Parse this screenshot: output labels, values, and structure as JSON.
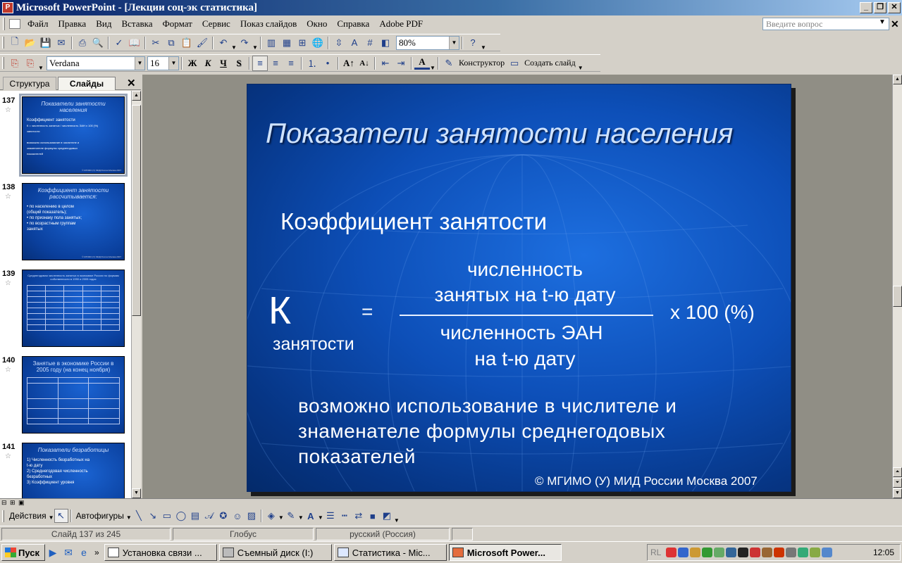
{
  "window": {
    "title": "Microsoft PowerPoint - [Лекции соц-эк статистика]"
  },
  "menu": {
    "items": [
      "Файл",
      "Правка",
      "Вид",
      "Вставка",
      "Формат",
      "Сервис",
      "Показ слайдов",
      "Окно",
      "Справка",
      "Adobe PDF"
    ],
    "help_placeholder": "Введите вопрос"
  },
  "toolbar": {
    "zoom": "80%",
    "font_name": "Verdana",
    "font_size": "16",
    "bold_label": "Ж",
    "italic_label": "К",
    "underline_label": "Ч",
    "shadow_label": "S",
    "designer_label": "Конструктор",
    "new_slide_label": "Создать слайд"
  },
  "left_panel": {
    "tab_structure": "Структура",
    "tab_slides": "Слайды",
    "thumbnails": [
      {
        "number": "137",
        "title": "Показатели занятости населения",
        "lines": [
          "Коэффициент занятости",
          "К  =  численность занятых / численность ЭАН  x 100 (%)",
          "занятости",
          "возможно использование в числителе и",
          "знаменателе формулы среднегодовых",
          "показателей"
        ]
      },
      {
        "number": "138",
        "title": "Коэффициент занятости рассчитывается:",
        "lines": [
          "• по населению в целом",
          "  (общий показатель);",
          "• по признаку пола занятых;",
          "• по возрастным группам",
          "  занятых"
        ]
      },
      {
        "number": "139",
        "title": "Среднегодовая численность занятых в экономике России по формам собственности в 1990 и 2005 годах",
        "lines": []
      },
      {
        "number": "140",
        "title": "Занятые в экономике России в 2005 году (на конец ноября)",
        "lines": []
      },
      {
        "number": "141",
        "title": "Показатели безработицы",
        "lines": [
          "1) Численность безработных на",
          "   t-ю дату",
          "2) Среднегодовая численность",
          "   безработных",
          "3) Коэффициент уровня"
        ]
      }
    ]
  },
  "slide": {
    "title": "Показатели занятости населения",
    "heading": "Коэффициент занятости",
    "k_letter": "К",
    "k_subscript": "занятости",
    "equals": "=",
    "numerator_line1": "численность",
    "numerator_line2": "занятых на t-ю дату",
    "denominator_line1": "численность ЭАН",
    "denominator_line2": "на t-ю дату",
    "multiplier": "x 100 (%)",
    "note": "возможно использование в числителе и знаменателе формулы среднегодовых показателей",
    "copyright": "© МГИМО (У) МИД России Москва 2007"
  },
  "drawing_toolbar": {
    "actions_label": "Действия",
    "autoshapes_label": "Автофигуры"
  },
  "status": {
    "slide_info": "Слайд 137 из 245",
    "design": "Глобус",
    "language": "русский (Россия)"
  },
  "taskbar": {
    "start_label": "Пуск",
    "tasks": [
      "Установка связи ...",
      "Съемный диск (I:)",
      "Статистика - Mic...",
      "Microsoft Power..."
    ],
    "lang_indicator": "RL",
    "clock": "12:05"
  }
}
